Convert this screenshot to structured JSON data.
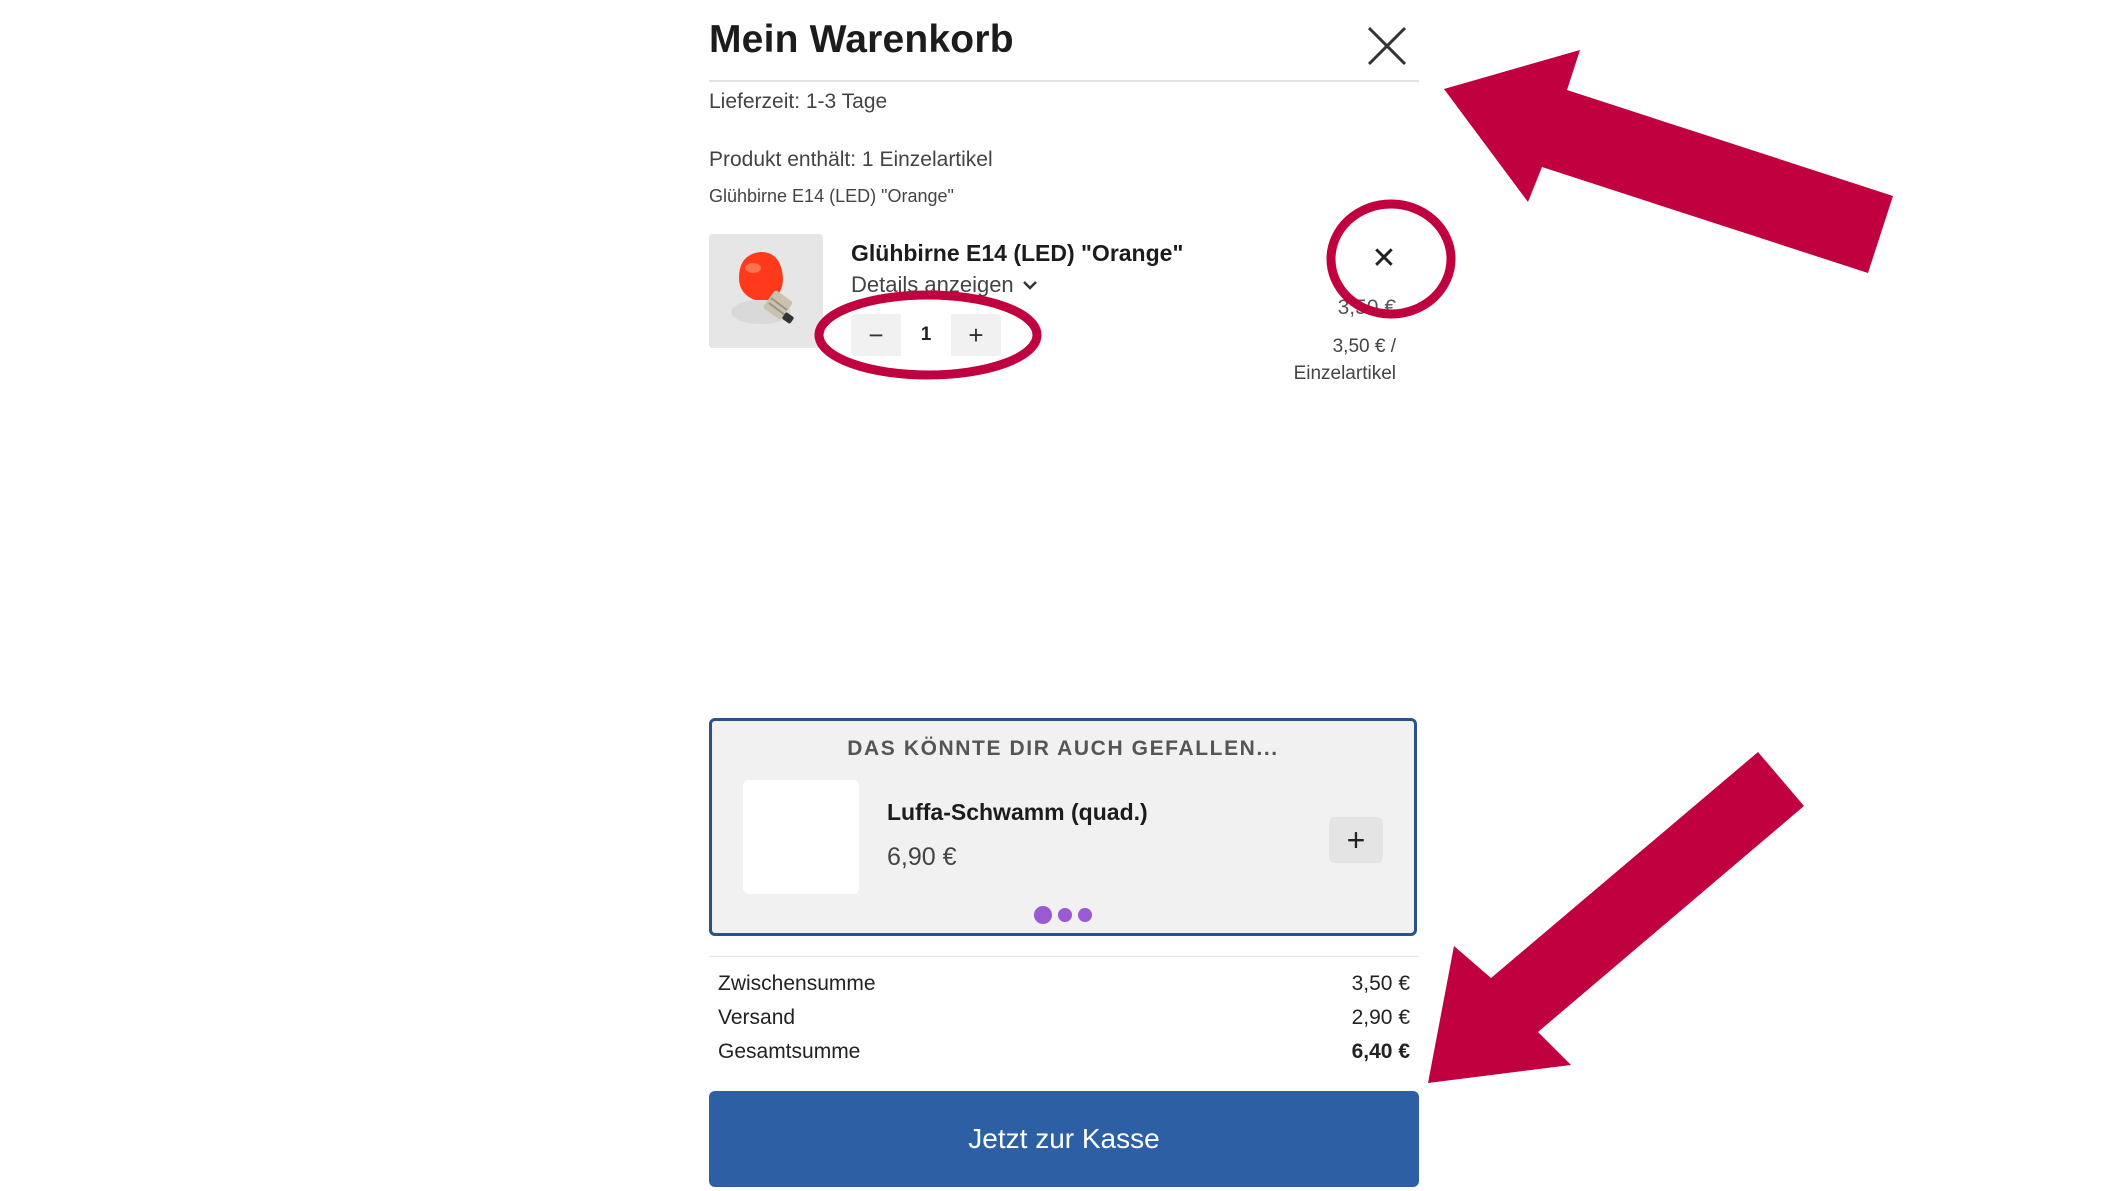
{
  "cart": {
    "title": "Mein Warenkorb",
    "delivery_time": "Lieferzeit: 1-3 Tage",
    "contains_label": "Produkt enthält: 1 Einzelartikel",
    "contains_item": "Glühbirne E14 (LED) \"Orange\""
  },
  "item": {
    "name": "Glühbirne E14 (LED) \"Orange\"",
    "details_label": "Details anzeigen",
    "quantity": "1",
    "minus_label": "−",
    "plus_label": "+",
    "remove_label": "✕",
    "price": "3,50 €",
    "unit_price_line1": "3,50 € /",
    "unit_price_line2": "Einzelartikel"
  },
  "recommendation": {
    "title": "DAS KÖNNTE DIR AUCH GEFALLEN...",
    "name": "Luffa-Schwamm (quad.)",
    "price": "6,90 €",
    "add_label": "+",
    "page_count": 3,
    "active_page": 1
  },
  "summary": {
    "subtotal_label": "Zwischensumme",
    "subtotal_value": "3,50 €",
    "shipping_label": "Versand",
    "shipping_value": "2,90 €",
    "total_label": "Gesamtsumme",
    "total_value": "6,40 €"
  },
  "checkout": {
    "label": "Jetzt zur Kasse"
  },
  "icons": {
    "close": "close-icon",
    "chevron": "chevron-down-icon",
    "remove": "remove-icon",
    "add": "plus-icon",
    "annotation_arrows": "arrow-annotation",
    "annotation_circles": "circle-annotation"
  },
  "colors": {
    "checkout_button": "#2c5fa4",
    "reco_border": "#2a5289",
    "carousel_dot": "#9b59d4",
    "annotation": "#c0003f"
  }
}
